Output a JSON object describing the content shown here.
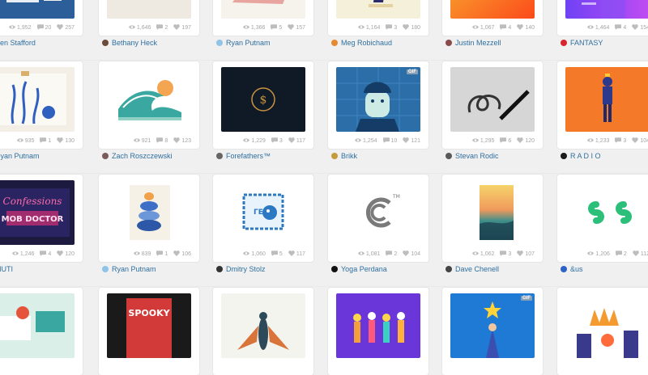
{
  "shots": [
    {
      "author": "Ben Stafford",
      "views": "1,952",
      "comments": "20",
      "likes": "257",
      "thumb": "blue-machine",
      "avatar_color": "#3b6ea5"
    },
    {
      "author": "Bethany Heck",
      "views": "1,646",
      "comments": "2",
      "likes": "197",
      "thumb": "beige-sign",
      "avatar_color": "#6b4b3a"
    },
    {
      "author": "Ryan Putnam",
      "views": "1,366",
      "comments": "5",
      "likes": "157",
      "thumb": "pink-paper",
      "avatar_color": "#8fc4e8"
    },
    {
      "author": "Meg Robichaud",
      "views": "1,164",
      "comments": "3",
      "likes": "180",
      "thumb": "cream-figure",
      "avatar_color": "#e58a2e"
    },
    {
      "author": "Justin Mezzell",
      "views": "1,067",
      "comments": "4",
      "likes": "140",
      "thumb": "orange-gradient",
      "avatar_color": "#8a4b4b"
    },
    {
      "author": "FANTASY",
      "views": "1,464",
      "comments": "4",
      "likes": "154",
      "thumb": "purple-gradient",
      "avatar_color": "#d8262f"
    },
    {
      "author": "Ryan Putnam",
      "views": "935",
      "comments": "1",
      "likes": "130",
      "thumb": "blue-seaweed",
      "avatar_color": "#8fc4e8"
    },
    {
      "author": "Zach Roszczewski",
      "views": "921",
      "comments": "8",
      "likes": "123",
      "thumb": "wave-sun",
      "avatar_color": "#7a5a5a"
    },
    {
      "author": "Forefathers™",
      "views": "1,229",
      "comments": "3",
      "likes": "117",
      "thumb": "dark-logo",
      "avatar_color": "#666666"
    },
    {
      "author": "Brikk",
      "views": "1,254",
      "comments": "10",
      "likes": "121",
      "thumb": "blue-face",
      "avatar_color": "#c49a3a",
      "gif": "GIF"
    },
    {
      "author": "Stevan Rodic",
      "views": "1,295",
      "comments": "6",
      "likes": "120",
      "thumb": "pen-sketch",
      "avatar_color": "#5a5a5a"
    },
    {
      "author": "R A D I O",
      "views": "1,233",
      "comments": "3",
      "likes": "104",
      "thumb": "orange-man",
      "avatar_color": "#1a1a1a"
    },
    {
      "author": "MUTI",
      "views": "1,246",
      "comments": "4",
      "likes": "120",
      "thumb": "neon-confessions",
      "avatar_color": "#222222"
    },
    {
      "author": "Ryan Putnam",
      "views": "839",
      "comments": "1",
      "likes": "106",
      "thumb": "stacked-stones",
      "avatar_color": "#8fc4e8"
    },
    {
      "author": "Dmitry Stolz",
      "views": "1,060",
      "comments": "5",
      "likes": "117",
      "thumb": "stamp-face",
      "avatar_color": "#333333"
    },
    {
      "author": "Yoga Perdana",
      "views": "1,081",
      "comments": "2",
      "likes": "104",
      "thumb": "c-logo",
      "avatar_color": "#111111"
    },
    {
      "author": "Dave Chenell",
      "views": "1,062",
      "comments": "3",
      "likes": "107",
      "thumb": "desert-sunset",
      "avatar_color": "#444444"
    },
    {
      "author": "&us",
      "views": "1,206",
      "comments": "2",
      "likes": "112",
      "thumb": "s-logo",
      "avatar_color": "#2b63c6"
    },
    {
      "thumb": "teal-office"
    },
    {
      "thumb": "spooky-pack"
    },
    {
      "thumb": "moth"
    },
    {
      "thumb": "purple-band"
    },
    {
      "thumb": "blue-wizard",
      "gif": "GIF"
    },
    {
      "thumb": "crowd-fire"
    }
  ]
}
